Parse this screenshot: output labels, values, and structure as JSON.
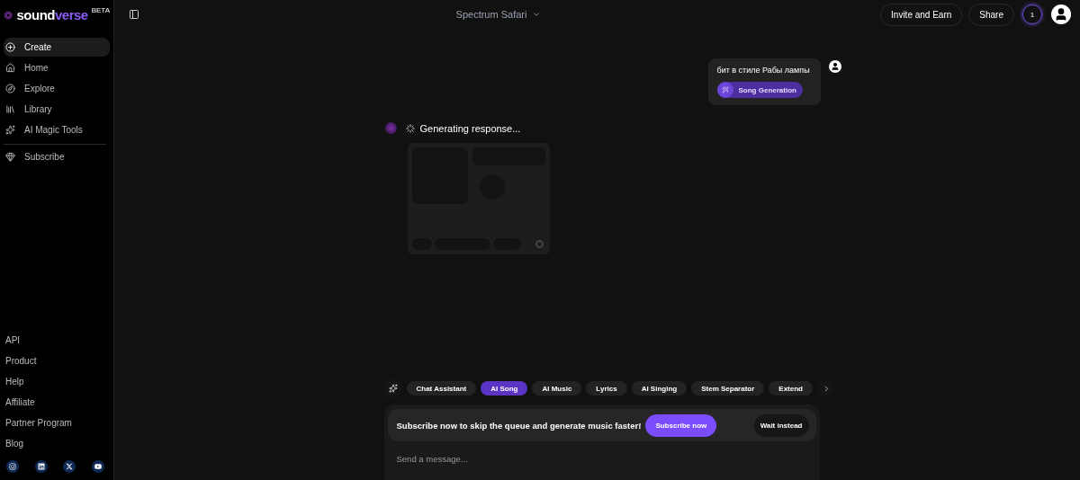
{
  "logo": {
    "word": "sound",
    "accent": "verse",
    "badge": "BETA"
  },
  "nav": [
    {
      "label": "Create",
      "selected": true
    },
    {
      "label": "Home",
      "selected": false
    },
    {
      "label": "Explore",
      "selected": false
    },
    {
      "label": "Library",
      "selected": false
    },
    {
      "label": "AI Magic Tools",
      "selected": false
    }
  ],
  "subscribe": {
    "label": "Subscribe"
  },
  "footer_links": [
    "API",
    "Product",
    "Help",
    "Affiliate",
    "Partner Program",
    "Blog"
  ],
  "header": {
    "title": "Spectrum Safari",
    "buttons": [
      "Invite and Earn",
      "Share"
    ],
    "credits": "1"
  },
  "user_message": {
    "text": "бит в стиле Рабы лампы",
    "tag": "Song Generation"
  },
  "response": {
    "status": "Generating response..."
  },
  "modes": [
    {
      "label": "Chat Assistant",
      "selected": false
    },
    {
      "label": "AI Song",
      "selected": true
    },
    {
      "label": "AI Music",
      "selected": false
    },
    {
      "label": "Lyrics",
      "selected": false
    },
    {
      "label": "AI Singing",
      "selected": false
    },
    {
      "label": "Stem Separator",
      "selected": false
    },
    {
      "label": "Extend",
      "selected": false
    }
  ],
  "banner": {
    "text": "Subscribe now to skip the queue and generate music faster!",
    "primary": "Subscribe now",
    "secondary": "Wait instead"
  },
  "composer": {
    "placeholder": "Send a message..."
  }
}
